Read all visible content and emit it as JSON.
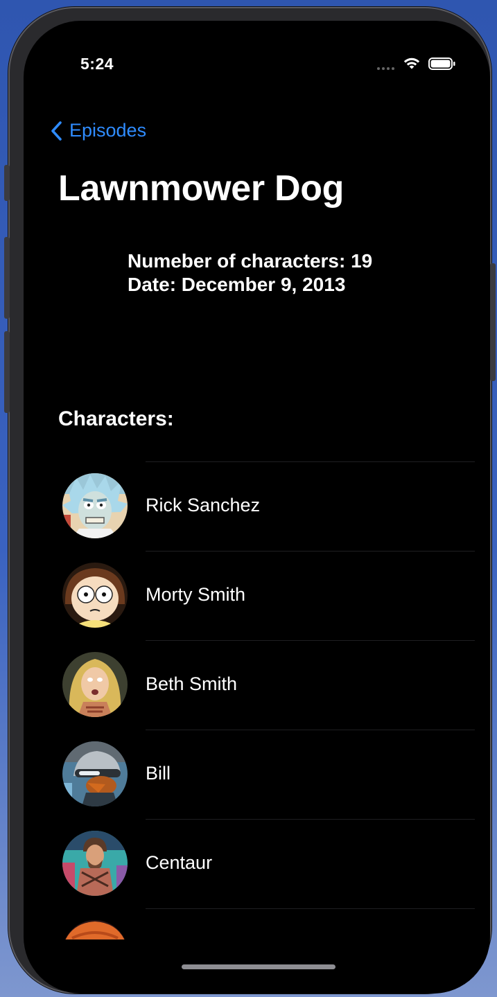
{
  "status_bar": {
    "time": "5:24"
  },
  "nav": {
    "back_label": "Episodes"
  },
  "episode": {
    "title": "Lawnmower Dog",
    "characters_count_text": "Numeber of characters: 19",
    "date_text": "Date: December 9, 2013"
  },
  "characters_section": {
    "heading": "Characters:",
    "items": [
      {
        "name": "Rick Sanchez"
      },
      {
        "name": "Morty Smith"
      },
      {
        "name": "Beth Smith"
      },
      {
        "name": "Bill"
      },
      {
        "name": "Centaur"
      },
      {
        "name": ""
      }
    ]
  },
  "colors": {
    "accent": "#2f8cff",
    "background": "#000000",
    "text": "#ffffff"
  }
}
